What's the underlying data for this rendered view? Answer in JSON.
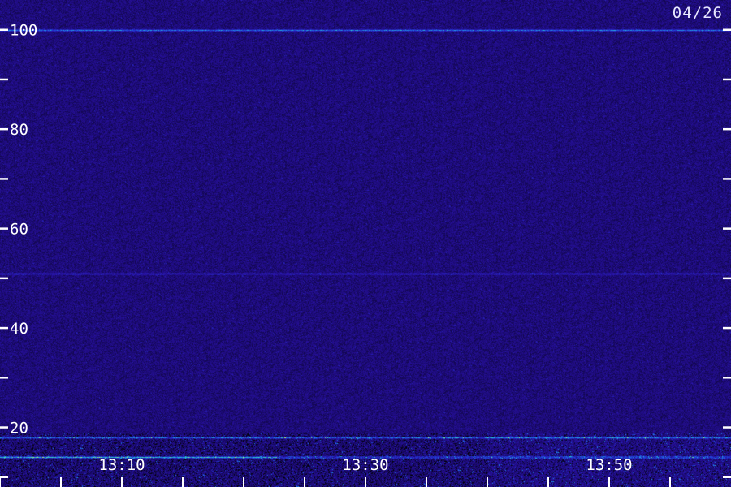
{
  "date_label": "04/26",
  "chart_data": {
    "type": "heatmap",
    "title": "",
    "xlabel": "",
    "ylabel": "",
    "ylim": [
      8,
      106
    ],
    "y_ticks": [
      10,
      20,
      30,
      40,
      50,
      60,
      70,
      80,
      90,
      100
    ],
    "y_tick_labels": [
      "20",
      "40",
      "60",
      "80",
      "100"
    ],
    "x_tick_labels": [
      "13:10",
      "13:30",
      "13:50"
    ],
    "x_minor_tick_count": 12,
    "colormap": [
      "#000000",
      "#1a0a6e",
      "#2a12a8",
      "#1f3fd8",
      "#20a0e8",
      "#30e0c0",
      "#c8ff60"
    ],
    "background_color": "#1d0a72",
    "persistent_lines": [
      {
        "y": 100,
        "intensity": "medium"
      },
      {
        "y": 51,
        "intensity": "low"
      },
      {
        "y": 18,
        "intensity": "medium"
      },
      {
        "y": 14,
        "intensity": "high"
      }
    ]
  }
}
